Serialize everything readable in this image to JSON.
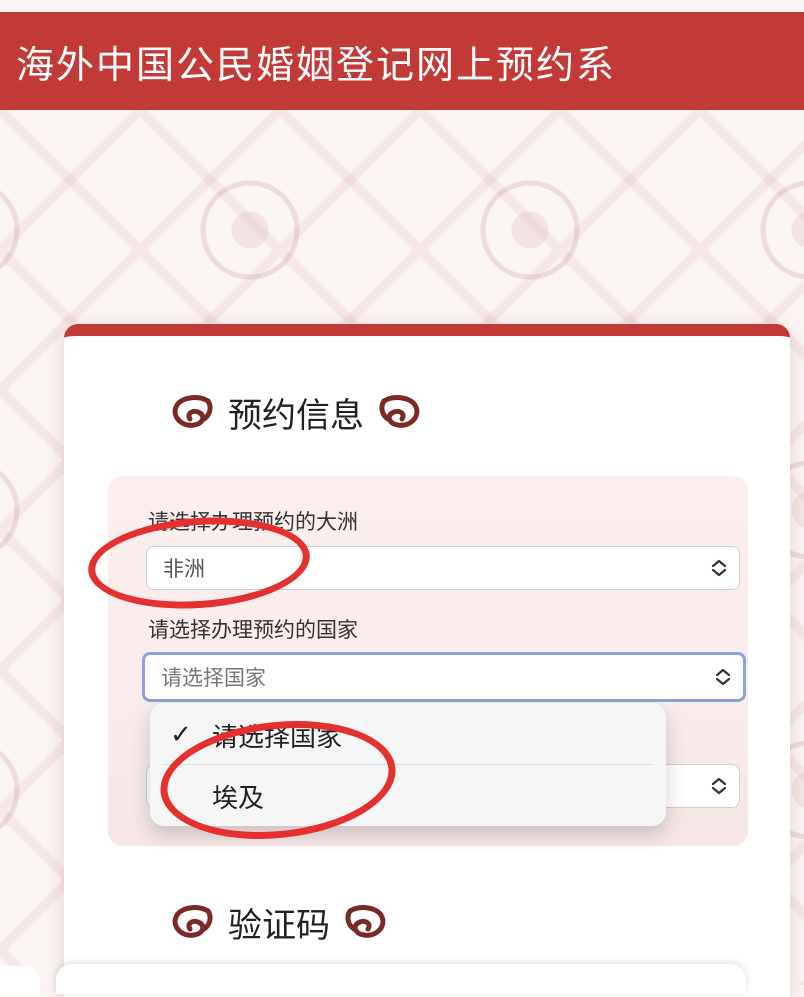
{
  "header": {
    "title": "海外中国公民婚姻登记网上预约系"
  },
  "card": {
    "section1_title": "预约信息",
    "section2_title": "验证码",
    "continent": {
      "label": "请选择办理预约的大洲",
      "value": "非洲"
    },
    "country": {
      "label": "请选择办理预约的国家",
      "value": "请选择国家"
    },
    "third_field": {
      "label": ""
    }
  },
  "dropdown": {
    "options": [
      {
        "label": "请选择国家",
        "checked": true
      },
      {
        "label": "埃及",
        "checked": false
      }
    ]
  },
  "colors": {
    "brand": "#c23a37",
    "focus": "#8fa0dc",
    "annotation": "#e53030"
  }
}
